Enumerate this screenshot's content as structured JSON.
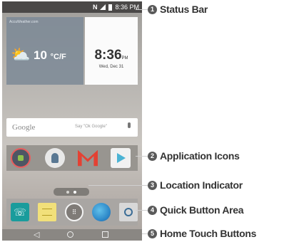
{
  "status_bar": {
    "nfc": "N",
    "time": "8:36 PM"
  },
  "weather": {
    "source": "AccuWeather.com",
    "icon": "partly-sunny-icon",
    "temperature": "10",
    "unit": "°C/F"
  },
  "clock": {
    "time": "8:36",
    "ampm": "PM",
    "date": "Wed, Dec 31"
  },
  "search_bar": {
    "logo": "Google",
    "hint": "Say \"Ok Google\""
  },
  "app_icons": [
    "apps-folder-icon",
    "contacts-icon",
    "gmail-icon",
    "play-store-icon"
  ],
  "quick_buttons": [
    "phone-icon",
    "messaging-icon",
    "apps-drawer-icon",
    "browser-icon",
    "camera-icon"
  ],
  "home_buttons": {
    "back": "◁"
  },
  "callouts": [
    {
      "number": "1",
      "label": "Status Bar"
    },
    {
      "number": "2",
      "label": "Application Icons"
    },
    {
      "number": "3",
      "label": "Location Indicator"
    },
    {
      "number": "4",
      "label": "Quick Button Area"
    },
    {
      "number": "5",
      "label": "Home Touch Buttons"
    }
  ]
}
